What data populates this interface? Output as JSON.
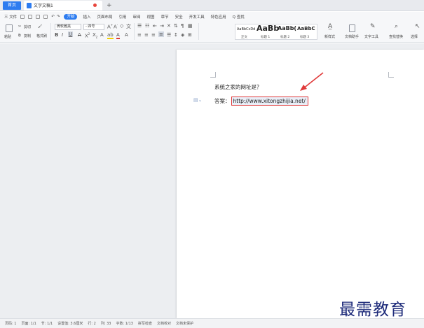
{
  "titlebar": {
    "home_tab": "首页",
    "doc_tab": "文字文稿1",
    "new_tab": "+"
  },
  "menu": {
    "file": "三 文件",
    "start": "开始",
    "items": [
      "插入",
      "页面布局",
      "引用",
      "审阅",
      "视图",
      "章节",
      "安全",
      "开发工具",
      "特色应用",
      "Q 查找"
    ]
  },
  "ribbon": {
    "paste": "粘贴",
    "cut": "剪切",
    "copy": "复制",
    "format_painter": "格式刷",
    "font_name": "微软雅黑",
    "font_size": "- 四号",
    "styles": [
      {
        "preview": "AaBbCcDd",
        "label": "正文"
      },
      {
        "preview": "AaBb",
        "label": "标题 1"
      },
      {
        "preview": "AaBb(",
        "label": "标题 2"
      },
      {
        "preview": "AaBbC",
        "label": "标题 3"
      }
    ],
    "new_style": "新样式",
    "text_assistant": "文档助手",
    "text_tools": "文字工具",
    "find_replace": "查找替换",
    "select": "选择"
  },
  "document": {
    "question": "系统之家的网址是？",
    "answer_label": "答案：",
    "answer_url": "http://www.xitongzhijia.net/"
  },
  "statusbar": {
    "items": [
      "页码: 1",
      "页面: 1/1",
      "节: 1/1",
      "设置值: 3.6厘米",
      "行: 2",
      "列: 33",
      "字数: 1/13",
      "拼写检查",
      "文档校对",
      "文档未保护"
    ]
  },
  "watermark": "最需教育",
  "colors": {
    "accent": "#2d7cf0",
    "highlight_border": "#e03a3a",
    "arrow": "#e03a3a",
    "workspace": "#eceef1",
    "watermark": "#1e2b7a"
  }
}
